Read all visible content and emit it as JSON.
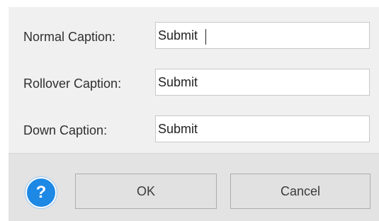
{
  "fields": [
    {
      "label": "Normal Caption:",
      "value": "Submit",
      "focused": true
    },
    {
      "label": "Rollover Caption:",
      "value": "Submit"
    },
    {
      "label": "Down Caption:",
      "value": "Submit"
    }
  ],
  "footer": {
    "help_icon": "?",
    "ok_label": "OK",
    "cancel_label": "Cancel"
  },
  "colors": {
    "dialog_bg": "#f0f0f0",
    "footer_bg": "#e3e3e3",
    "help_accent": "#1e88e5",
    "button_bg": "#e1e1e1"
  },
  "icons": {
    "help": "question-mark-icon"
  }
}
